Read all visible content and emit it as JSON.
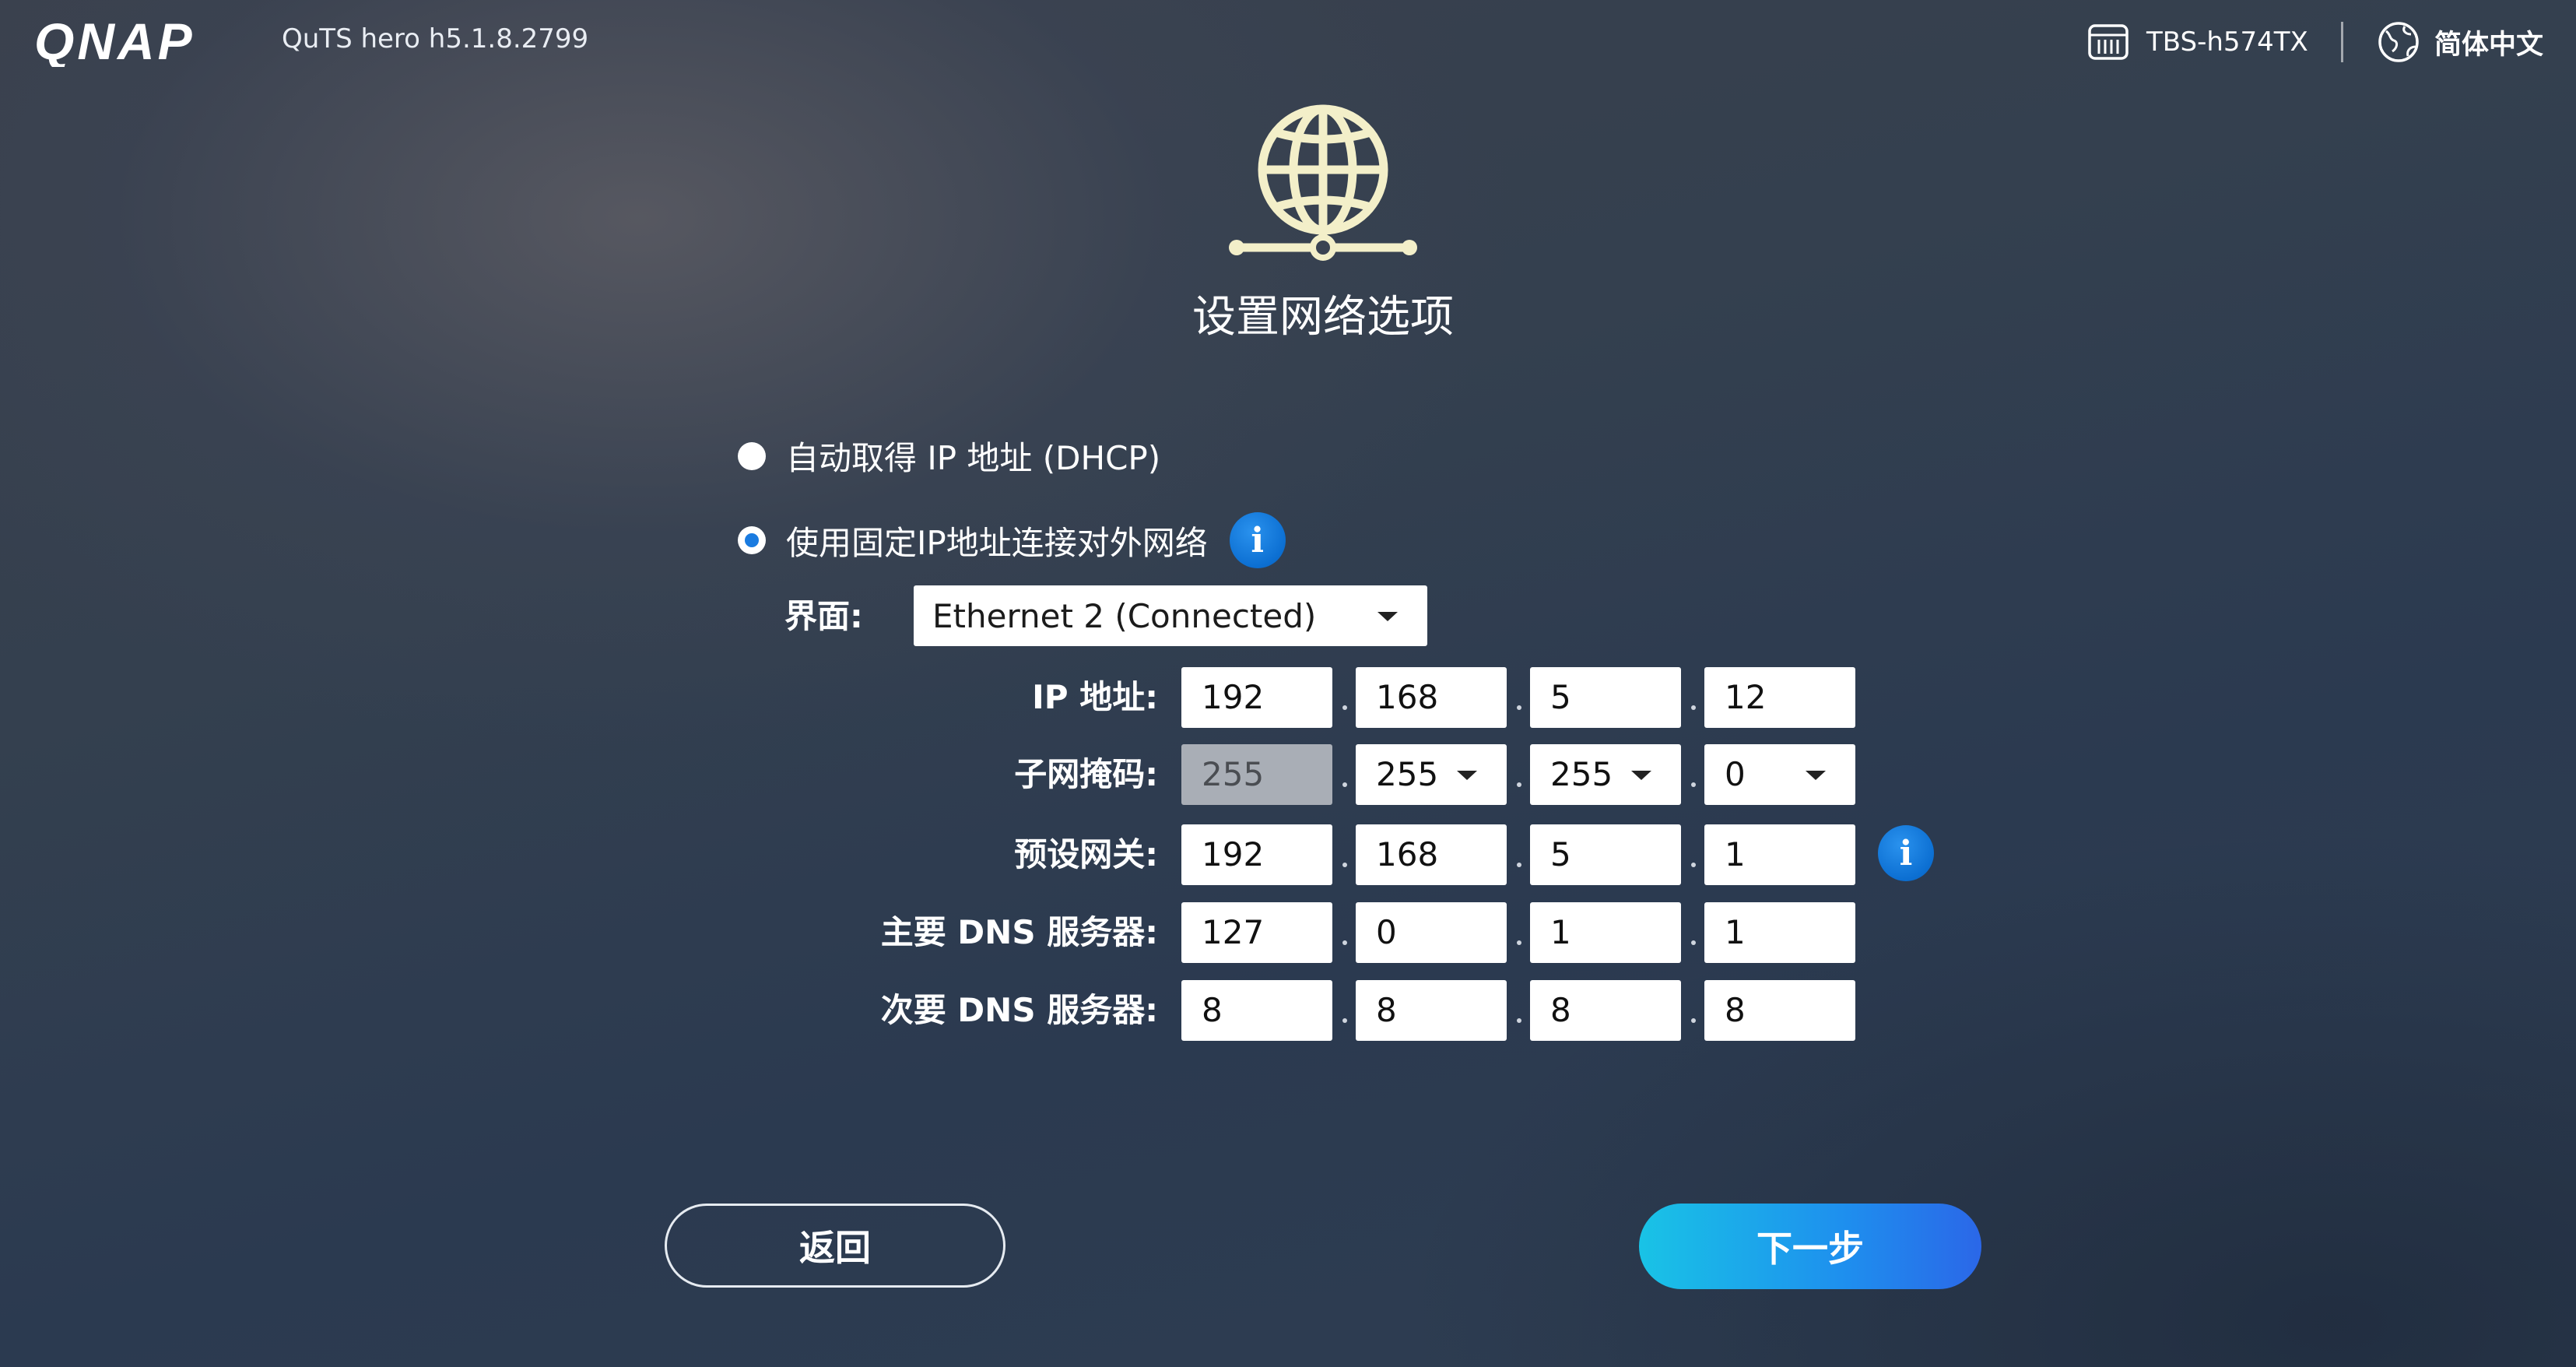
{
  "header": {
    "brand": "QNAP",
    "version": "QuTS hero h5.1.8.2799",
    "device_name": "TBS-h574TX",
    "language": "简体中文"
  },
  "page": {
    "title": "设置网络选项"
  },
  "options": {
    "dhcp_label": "自动取得 IP 地址 (DHCP)",
    "static_label": "使用固定IP地址连接对外网络",
    "selected": "static"
  },
  "interface": {
    "label": "界面:",
    "value": "Ethernet 2 (Connected)"
  },
  "fields": {
    "ip": {
      "label": "IP 地址:",
      "octets": [
        "192",
        "168",
        "5",
        "12"
      ]
    },
    "subnet": {
      "label": "子网掩码:",
      "octets": [
        "255",
        "255",
        "255",
        "0"
      ]
    },
    "gateway": {
      "label": "预设网关:",
      "octets": [
        "192",
        "168",
        "5",
        "1"
      ]
    },
    "dns1": {
      "label": "主要 DNS 服务器:",
      "octets": [
        "127",
        "0",
        "1",
        "1"
      ]
    },
    "dns2": {
      "label": "次要 DNS 服务器:",
      "octets": [
        "8",
        "8",
        "8",
        "8"
      ]
    }
  },
  "buttons": {
    "back": "返回",
    "next": "下一步"
  },
  "colors": {
    "accent": "#1a7be0",
    "next_gradient_start": "#19c3e6",
    "next_gradient_end": "#2b67e8",
    "globe": "#f3efc9"
  }
}
